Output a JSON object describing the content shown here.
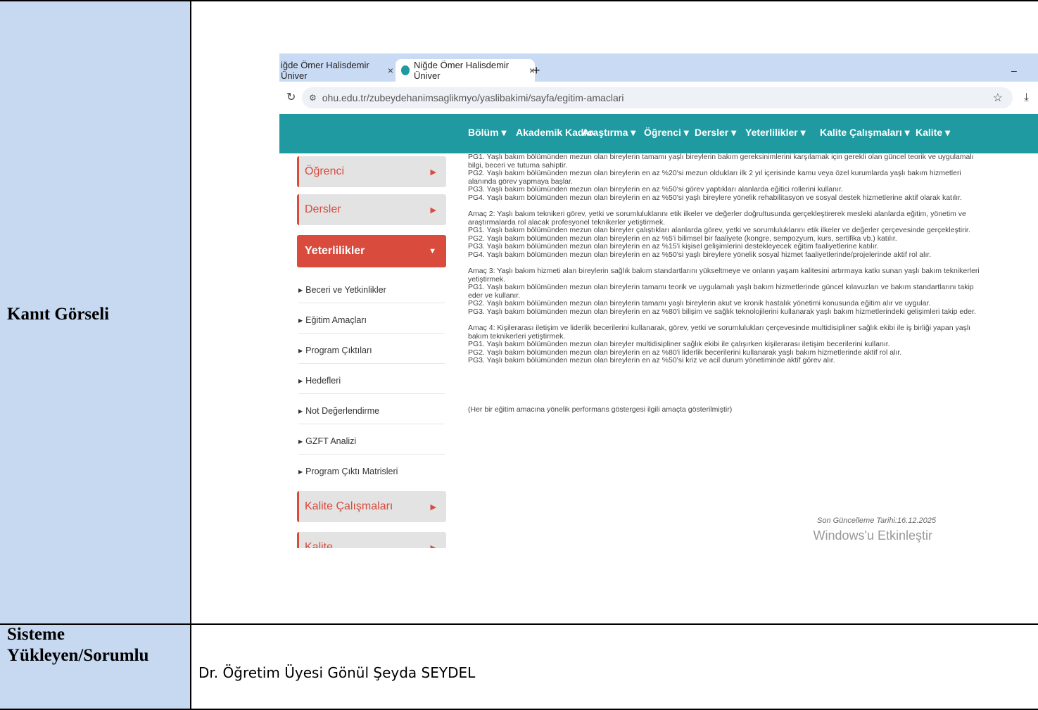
{
  "table": {
    "row1_label": "Kanıt Görseli",
    "row2_label": "Sisteme Yükleyen/Sorumlu",
    "row2_value": "Dr. Öğretim Üyesi Gönül Şeyda SEYDEL"
  },
  "browser": {
    "tab1": "iğde Ömer Halisdemir Üniver",
    "tab2": "Niğde Ömer Halisdemir Üniver",
    "tab_close": "×",
    "new_tab": "+",
    "minimize": "–",
    "url": "ohu.edu.tr/zubeydehanimsaglikmyo/yaslibakimi/sayfa/egitim-amaclari"
  },
  "nav": {
    "items": [
      "Bölüm ▾",
      "Akademik Kadro",
      "Araştırma ▾",
      "Öğrenci ▾",
      "Dersler ▾",
      "Yeterlilikler ▾",
      "Kalite Çalışmaları ▾",
      "Kalite ▾"
    ]
  },
  "sidebar": {
    "ogrenci": "Öğrenci",
    "dersler": "Dersler",
    "yeterlilikler": "Yeterlilikler",
    "sub": [
      "Beceri ve Yetkinlikler",
      "Eğitim Amaçları",
      "Program Çıktıları",
      "Hedefleri",
      "Not Değerlendirme",
      "GZFT Analizi",
      "Program Çıktı Matrisleri"
    ],
    "kalite_calismalari": "Kalite Çalışmaları",
    "kalite": "Kalite"
  },
  "content": {
    "block1": [
      "PG1. Yaşlı bakım bölümünden mezun olan bireylerin tamamı yaşlı bireylerin bakım gereksinimlerini karşılamak için gerekli olan güncel teorik ve uygulamalı",
      "bilgi, beceri ve tutuma sahiptir.",
      "PG2. Yaşlı bakım bölümünden mezun olan bireylerin en az %20'si mezun oldukları ilk 2 yıl içerisinde kamu veya özel kurumlarda yaşlı bakım hizmetleri",
      "alanında görev yapmaya başlar.",
      "PG3. Yaşlı bakım bölümünden mezun olan bireylerin en az %50'si görev yaptıkları alanlarda eğitici rollerini kullanır.",
      "PG4. Yaşlı bakım bölümünden mezun olan bireylerin en az %50'si yaşlı bireylere yönelik rehabilitasyon ve sosyal destek hizmetlerine aktif olarak katılır."
    ],
    "block2": [
      "Amaç 2: Yaşlı bakım teknikeri görev, yetki ve sorumluluklarını etik ilkeler ve değerler doğrultusunda gerçekleştirerek mesleki alanlarda eğitim, yönetim ve",
      "araştırmalarda rol alacak profesyonel teknikerler yetiştirmek.",
      "PG1. Yaşlı bakım bölümünden mezun olan bireyler çalıştıkları alanlarda görev, yetki ve sorumluluklarını etik ilkeler ve değerler çerçevesinde gerçekleştirir.",
      "PG2. Yaşlı bakım bölümünden mezun olan bireylerin en az %5'i bilimsel bir faaliyete (kongre, sempozyum, kurs, sertifika vb.) katılır.",
      "PG3. Yaşlı bakım bölümünden mezun olan bireylerin en az %15'i kişisel gelişimlerini destekleyecek eğitim faaliyetlerine katılır.",
      "PG4. Yaşlı bakım bölümünden mezun olan bireylerin en az %50'si yaşlı bireylere yönelik sosyal hizmet faaliyetlerinde/projelerinde aktif rol alır."
    ],
    "block3": [
      "Amaç 3: Yaşlı bakım hizmeti alan bireylerin sağlık bakım standartlarını yükseltmeye ve onların yaşam kalitesini artırmaya katkı sunan yaşlı bakım teknikerleri",
      "yetiştirmek.",
      "PG1. Yaşlı bakım bölümünden mezun olan bireylerin tamamı teorik ve uygulamalı yaşlı bakım hizmetlerinde güncel kılavuzları ve bakım standartlarını takip",
      "eder ve kullanır.",
      "PG2. Yaşlı bakım bölümünden mezun olan bireylerin tamamı yaşlı bireylerin akut ve kronik hastalık yönetimi konusunda eğitim alır ve uygular.",
      "PG3. Yaşlı bakım bölümünden mezun olan bireylerin en az %80'i bilişim ve sağlık teknolojilerini kullanarak yaşlı bakım hizmetlerindeki gelişimleri takip eder."
    ],
    "block4": [
      "Amaç 4: Kişilerarası iletişim ve liderlik becerilerini kullanarak, görev, yetki ve sorumlulukları çerçevesinde multidisipliner sağlık ekibi ile iş birliği yapan yaşlı",
      "bakım teknikerleri yetiştirmek.",
      "PG1. Yaşlı bakım bölümünden mezun olan bireyler multidisipliner sağlık ekibi ile çalışırken kişilerarası iletişim becerilerini kullanır.",
      "PG2. Yaşlı bakım bölümünden mezun olan bireylerin en az %80'i liderlik becerilerini kullanarak yaşlı bakım hizmetlerinde aktif rol alır.",
      "PG3. Yaşlı bakım bölümünden mezun olan bireylerin en az %50'si kriz ve acil durum yönetiminde aktif görev alır."
    ],
    "note": "(Her bir eğitim amacına yönelik performans göstergesi ilgili amaçta gösterilmiştir)",
    "updated": "Son Güncelleme Tarihi:16.12.2025",
    "watermark": "Windows'u Etkinleştir"
  },
  "colors": {
    "teal": "#1e9aa0",
    "red": "#d84b3d",
    "label_bg": "#c6d9f1"
  }
}
